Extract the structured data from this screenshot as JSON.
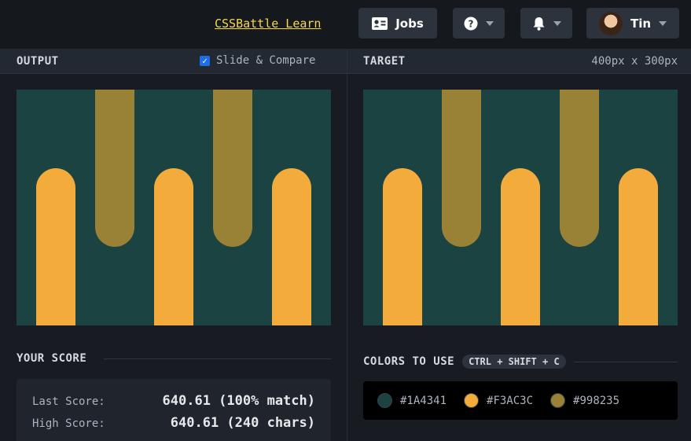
{
  "topbar": {
    "learn_link": "CSSBattle Learn",
    "jobs_label": "Jobs",
    "user_name": "Tin"
  },
  "output_panel": {
    "title": "OUTPUT",
    "compare_label": "Slide & Compare",
    "compare_checked": true
  },
  "target_panel": {
    "title": "TARGET",
    "dimensions": "400px x 300px"
  },
  "score": {
    "heading": "YOUR SCORE",
    "last_label": "Last Score:",
    "last_value": "640.61 (100% match)",
    "high_label": "High Score:",
    "high_value": "640.61 (240 chars)"
  },
  "colors": {
    "heading": "COLORS TO USE",
    "shortcut": "CTRL + SHIFT + C",
    "list": [
      {
        "hex": "#1A4341"
      },
      {
        "hex": "#F3AC3C"
      },
      {
        "hex": "#998235"
      }
    ]
  },
  "icons": {
    "jobs": "id-card-icon",
    "help": "help-circle-icon",
    "notifications": "bell-icon",
    "caret": "chevron-down-icon"
  }
}
